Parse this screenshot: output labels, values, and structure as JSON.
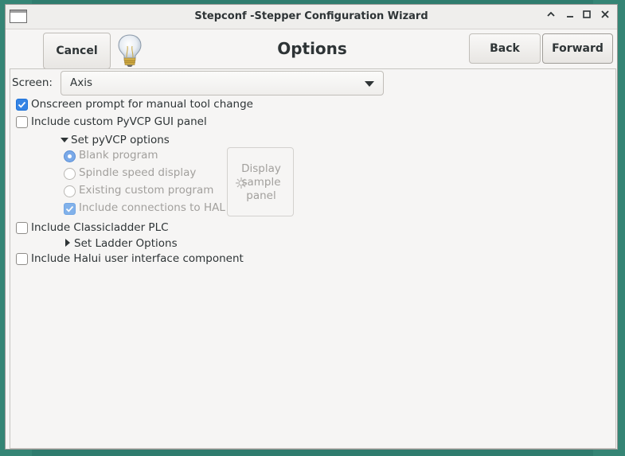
{
  "window": {
    "title": "Stepconf -Stepper Configuration Wizard"
  },
  "titlebar_controls": {
    "minimize": "⌃",
    "restore": "—",
    "maximize": "☐",
    "close": "✕"
  },
  "header": {
    "cancel_label": "Cancel",
    "page_title": "Options",
    "back_label": "Back",
    "forward_label": "Forward",
    "icon": "lightbulb-icon"
  },
  "screen": {
    "label": "Screen:",
    "value": "Axis"
  },
  "options": {
    "onscreen_prompt": {
      "label": "Onscreen prompt for manual tool change",
      "checked": true
    },
    "custom_pyvcp": {
      "label": "Include custom PyVCP GUI panel",
      "checked": false
    },
    "pyvcp_expander": {
      "label": "Set pyVCP options",
      "expanded": true
    },
    "pyvcp": {
      "blank": {
        "label": "Blank program",
        "selected": true
      },
      "spindle": {
        "label": "Spindle speed display",
        "selected": false
      },
      "existing": {
        "label": "Existing custom program",
        "selected": false
      },
      "hal_connections": {
        "label": "Include connections to HAL",
        "checked": true
      },
      "display_sample": {
        "line1": "Display",
        "line2": "sample",
        "line3": "panel"
      }
    },
    "classicladder": {
      "label": "Include Classicladder PLC",
      "checked": false
    },
    "ladder_expander": {
      "label": "Set Ladder Options",
      "expanded": false
    },
    "halui": {
      "label": "Include Halui user interface component",
      "checked": false
    }
  },
  "colors": {
    "accent": "#3584e4",
    "desktop": "#2f7c6e",
    "window_bg": "#f6f5f4"
  }
}
